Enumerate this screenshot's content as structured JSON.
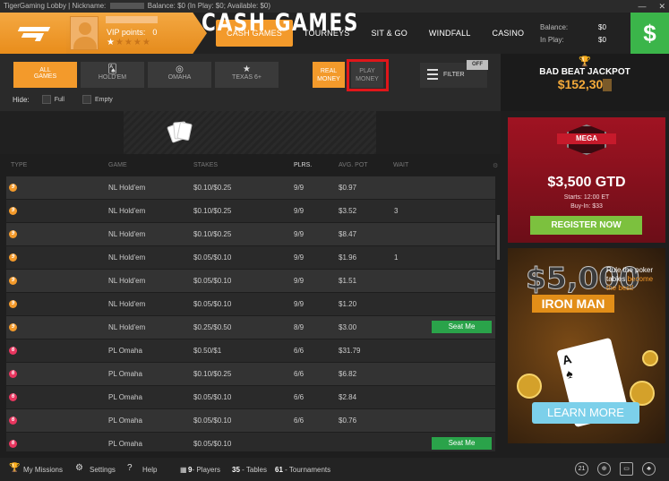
{
  "titlebar": {
    "prefix": "TigerGaming Lobby | Nickname:",
    "balance_text": "Balance: $0 (In Play: $0; Available: $0)"
  },
  "profile": {
    "vip_label": "VIP points:",
    "vip_value": "0"
  },
  "nav": {
    "items": [
      "CASH GAMES",
      "TOURNEYS",
      "SIT & GO",
      "WINDFALL",
      "CASINO"
    ]
  },
  "balance": {
    "balance_label": "Balance:",
    "in_play_label": "In Play:",
    "balance_value": "$0",
    "in_play_value": "$0",
    "cashier_symbol": "$"
  },
  "filters": {
    "game_types": [
      {
        "label_1": "ALL",
        "label_2": "GAMES",
        "icon": ""
      },
      {
        "label_1": "HOLD'EM",
        "label_2": "",
        "icon": "cards-icon"
      },
      {
        "label_1": "OMAHA",
        "label_2": "",
        "icon": "omaha-icon"
      },
      {
        "label_1": "TEXAS 6+",
        "label_2": "",
        "icon": "star-icon"
      }
    ],
    "real_money": [
      "REAL",
      "MONEY"
    ],
    "play_money": [
      "PLAY",
      "MONEY"
    ],
    "filter_label": "FILTER",
    "off_badge": "OFF",
    "hide_label": "Hide:",
    "hide_full": "Full",
    "hide_empty": "Empty"
  },
  "banner": {
    "title": "CASH GAMES"
  },
  "table": {
    "headers": [
      "TYPE",
      "GAME",
      "STAKES",
      "PLRS.",
      "AVG. POT",
      "WAIT"
    ],
    "rows": [
      {
        "type": "holdem",
        "game": "NL Hold'em",
        "stakes": "$0.10/$0.25",
        "plrs": "9/9",
        "pot": "$0.97",
        "wait": "",
        "seat": ""
      },
      {
        "type": "holdem",
        "game": "NL Hold'em",
        "stakes": "$0.10/$0.25",
        "plrs": "9/9",
        "pot": "$3.52",
        "wait": "3",
        "seat": ""
      },
      {
        "type": "holdem",
        "game": "NL Hold'em",
        "stakes": "$0.10/$0.25",
        "plrs": "9/9",
        "pot": "$8.47",
        "wait": "",
        "seat": ""
      },
      {
        "type": "holdem",
        "game": "NL Hold'em",
        "stakes": "$0.05/$0.10",
        "plrs": "9/9",
        "pot": "$1.96",
        "wait": "1",
        "seat": ""
      },
      {
        "type": "holdem",
        "game": "NL Hold'em",
        "stakes": "$0.05/$0.10",
        "plrs": "9/9",
        "pot": "$1.51",
        "wait": "",
        "seat": ""
      },
      {
        "type": "holdem",
        "game": "NL Hold'em",
        "stakes": "$0.05/$0.10",
        "plrs": "9/9",
        "pot": "$1.20",
        "wait": "",
        "seat": ""
      },
      {
        "type": "holdem",
        "game": "NL Hold'em",
        "stakes": "$0.25/$0.50",
        "plrs": "8/9",
        "pot": "$3.00",
        "wait": "",
        "seat": "Seat Me"
      },
      {
        "type": "omaha",
        "game": "PL Omaha",
        "stakes": "$0.50/$1",
        "plrs": "6/6",
        "pot": "$31.79",
        "wait": "",
        "seat": ""
      },
      {
        "type": "omaha",
        "game": "PL Omaha",
        "stakes": "$0.10/$0.25",
        "plrs": "6/6",
        "pot": "$6.82",
        "wait": "",
        "seat": ""
      },
      {
        "type": "omaha",
        "game": "PL Omaha",
        "stakes": "$0.05/$0.10",
        "plrs": "6/6",
        "pot": "$2.84",
        "wait": "",
        "seat": ""
      },
      {
        "type": "omaha",
        "game": "PL Omaha",
        "stakes": "$0.05/$0.10",
        "plrs": "6/6",
        "pot": "$0.76",
        "wait": "",
        "seat": ""
      },
      {
        "type": "omaha",
        "game": "PL Omaha",
        "stakes": "$0.05/$0.10",
        "plrs": "",
        "pot": "",
        "wait": "",
        "seat": "Seat Me"
      }
    ]
  },
  "jackpot": {
    "label": "BAD BEAT JACKPOT",
    "amount": "$152,30"
  },
  "promo1": {
    "badge": "MEGA",
    "amount": "$3,500 GTD",
    "starts": "Starts: 12:00 ET",
    "buyin": "Buy-In: $33",
    "cta": "REGISTER NOW"
  },
  "promo2": {
    "big": "$5,000",
    "name": "IRON MAN",
    "tag_1": "Rule the poker tables",
    "tag_2": "become the best!",
    "cta": "LEARN MORE"
  },
  "footer": {
    "missions": "My Missions",
    "settings": "Settings",
    "help": "Help",
    "players_count": "9",
    "players_label": "- Players",
    "tables_count": "35",
    "tables_label": "- Tables",
    "tournaments_count": "61",
    "tournaments_label": "- Tournaments"
  },
  "colors": {
    "accent": "#f39a2b",
    "cashier": "#3bb54a",
    "seat_button": "#2aa34a",
    "highlight": "#e0161a"
  }
}
